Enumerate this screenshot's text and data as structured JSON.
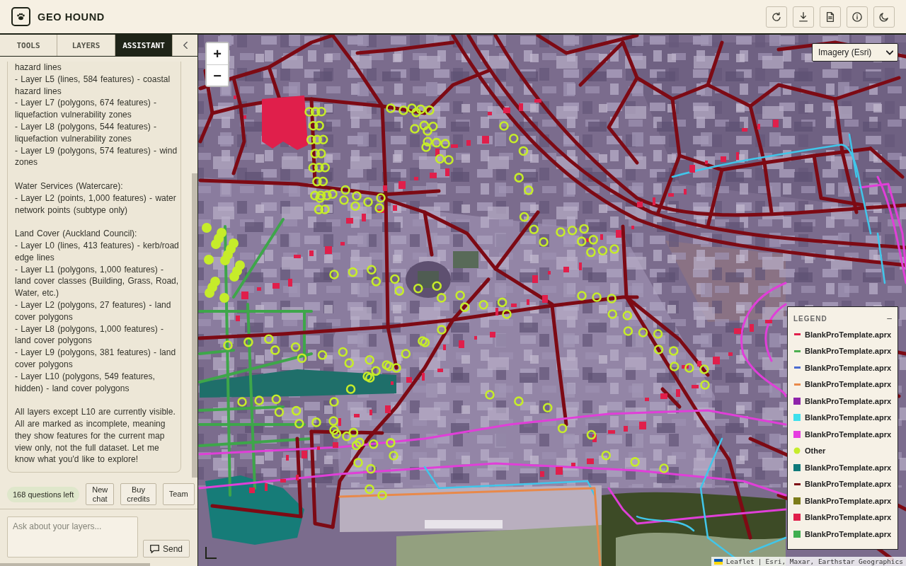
{
  "header": {
    "title": "GEO HOUND"
  },
  "sidebar": {
    "tabs": [
      {
        "label": "TOOLS",
        "selected": false
      },
      {
        "label": "LAYERS",
        "selected": false
      },
      {
        "label": "ASSISTANT",
        "selected": true
      }
    ],
    "message": {
      "blocks": [
        [
          "hazard lines",
          "- Layer L5 (lines, 584 features) - coastal hazard lines",
          "- Layer L7 (polygons, 674 features) - liquefaction vulnerability zones",
          "- Layer L8 (polygons, 544 features) - liquefaction vulnerability zones",
          "- Layer L9 (polygons, 574 features) - wind zones"
        ],
        [
          "Water Services (Watercare):",
          "- Layer L2 (points, 1,000 features) - water network points (subtype only)"
        ],
        [
          "Land Cover (Auckland Council):",
          "- Layer L0 (lines, 413 features) - kerb/road edge lines",
          "- Layer L1 (polygons, 1,000 features) - land cover classes (Building, Grass, Road, Water, etc.)",
          "- Layer L2 (polygons, 27 features) - land cover polygons",
          "- Layer L8 (polygons, 1,000 features) - land cover polygons",
          "- Layer L9 (polygons, 381 features) - land cover polygons",
          "- Layer L10 (polygons, 549 features, hidden) - land cover polygons"
        ],
        [
          "All layers except L10 are currently visible. All are marked as incomplete, meaning they show features for the current map view only, not the full dataset. Let me know what you'd like to explore!"
        ]
      ]
    },
    "quota": "168 questions left",
    "actions": [
      "New chat",
      "Buy credits",
      "Team"
    ],
    "composer": {
      "placeholder": "Ask about your layers...",
      "send": "Send"
    }
  },
  "map": {
    "zoom": [
      "+",
      "−"
    ],
    "basemap": "Imagery (Esri)",
    "legend": {
      "title": "LEGEND",
      "collapse": "–",
      "items": [
        {
          "label": "BlankProTemplate.aprx",
          "kind": "line",
          "color": "#e01f4b"
        },
        {
          "label": "BlankProTemplate.aprx",
          "kind": "line",
          "color": "#4caf50"
        },
        {
          "label": "BlankProTemplate.aprx",
          "kind": "line",
          "color": "#4a6bd0"
        },
        {
          "label": "BlankProTemplate.aprx",
          "kind": "line",
          "color": "#e8894a"
        },
        {
          "label": "BlankProTemplate.aprx",
          "kind": "polygon",
          "color": "#8e24aa"
        },
        {
          "label": "BlankProTemplate.aprx",
          "kind": "polygon",
          "color": "#3ee0ec"
        },
        {
          "label": "BlankProTemplate.aprx",
          "kind": "polygon",
          "color": "#e63ce0"
        },
        {
          "label": "Other",
          "kind": "point",
          "color": "#c6ec2a"
        },
        {
          "label": "BlankProTemplate.aprx",
          "kind": "polygon",
          "color": "#0f7a7a"
        },
        {
          "label": "BlankProTemplate.aprx",
          "kind": "line",
          "color": "#7d0a14"
        },
        {
          "label": "BlankProTemplate.aprx",
          "kind": "polygon",
          "color": "#7c7c1a"
        },
        {
          "label": "BlankProTemplate.aprx",
          "kind": "polygon",
          "color": "#e01f4b"
        },
        {
          "label": "BlankProTemplate.aprx",
          "kind": "polygon",
          "color": "#3fae4f"
        }
      ]
    },
    "attribution": {
      "link": "Leaflet",
      "separator": "|",
      "text": "Esri, Maxar, Earthstar Geographics"
    }
  }
}
